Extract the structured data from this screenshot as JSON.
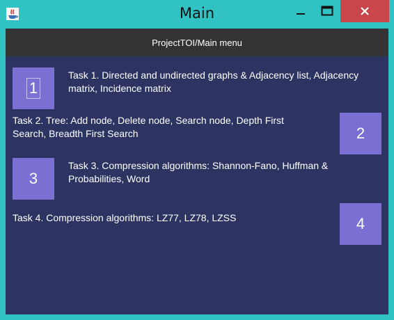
{
  "window": {
    "title": "Main",
    "controls": {
      "minimize_icon": "minimize-icon",
      "maximize_icon": "maximize-icon",
      "close_icon": "close-icon"
    }
  },
  "menu_bar": {
    "label": "ProjectTOI/Main menu"
  },
  "tasks": [
    {
      "button_label": "1",
      "description": "Task 1. Directed and undirected graphs & Adjacency list, Adjacency matrix, Incidence matrix"
    },
    {
      "button_label": "2",
      "description": "Task 2. Tree: Add node, Delete node, Search node, Depth First Search, Breadth First Search"
    },
    {
      "button_label": "3",
      "description": "Task 3. Compression algorithms: Shannon-Fano, Huffman & Probabilities, Word"
    },
    {
      "button_label": "4",
      "description": "Task 4. Compression algorithms: LZ77, LZ78, LZSS"
    }
  ],
  "colors": {
    "frame": "#31c3c3",
    "content_bg": "#2e3461",
    "menu_bar_bg": "#333333",
    "button_bg": "#7b6fd3",
    "close_bg": "#c9474b"
  }
}
